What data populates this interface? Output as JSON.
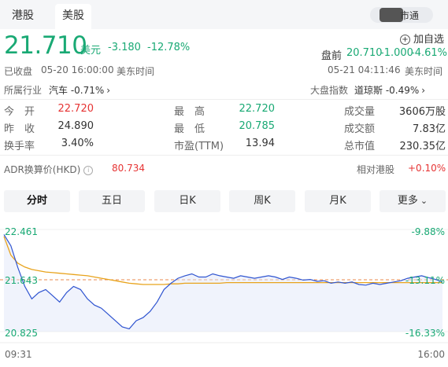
{
  "tabs": {
    "hk": "港股",
    "us": "美股"
  },
  "toggle_label": "市通",
  "quote": {
    "price": "21.710",
    "currency": "美元",
    "change": "-3.180",
    "change_pct": "-12.78%",
    "status": "已收盘",
    "close_time": "05-20 16:00:00",
    "tz": "美东时间",
    "add_watch": "加自选",
    "premarket_label": "盘前",
    "premarket_price": "20.710",
    "premarket_change": "-1.000",
    "premarket_pct": "-4.61%",
    "premarket_time": "05-21 04:11:46",
    "premarket_tz": "美东时间",
    "industry_label": "所属行业",
    "industry": "汽车 -0.71%",
    "index_label": "大盘指数",
    "index": "道琼斯 -0.49%"
  },
  "stats": {
    "open_label": "今　开",
    "open": "22.720",
    "high_label": "最　高",
    "high": "22.720",
    "volume_label": "成交量",
    "volume": "3606万股",
    "prev_label": "昨　收",
    "prev": "24.890",
    "low_label": "最　低",
    "low": "20.785",
    "turnover_label": "成交额",
    "turnover": "7.83亿",
    "rate_label": "换手率",
    "rate": "3.40%",
    "pe_label": "市盈(TTM)",
    "pe": "13.94",
    "mcap_label": "总市值",
    "mcap": "230.35亿"
  },
  "adr": {
    "label": "ADR换算价(HKD)",
    "value": "80.734",
    "rel_label": "相对港股",
    "rel_value": "+0.10%"
  },
  "period_tabs": [
    "分时",
    "五日",
    "日K",
    "周K",
    "月K",
    "更多"
  ],
  "chart_data": {
    "type": "line",
    "y_top_label": "22.461",
    "y_mid_label": "21.643",
    "y_bottom_label": "20.825",
    "pct_top_label": "-9.88%",
    "pct_mid_label": "-13.11%",
    "pct_bottom_label": "-16.33%",
    "x_start": "09:31",
    "x_end": "16:00",
    "ylim": [
      20.825,
      22.461
    ],
    "reference": 21.643,
    "series": [
      {
        "color": "#2f54d0",
        "values": [
          22.38,
          22.2,
          21.85,
          21.55,
          21.35,
          21.45,
          21.5,
          21.4,
          21.3,
          21.45,
          21.55,
          21.5,
          21.35,
          21.25,
          21.2,
          21.1,
          21.0,
          20.9,
          20.87,
          21.0,
          21.05,
          21.15,
          21.3,
          21.5,
          21.6,
          21.68,
          21.72,
          21.75,
          21.7,
          21.7,
          21.75,
          21.72,
          21.7,
          21.68,
          21.72,
          21.7,
          21.68,
          21.7,
          21.72,
          21.7,
          21.66,
          21.7,
          21.68,
          21.65,
          21.66,
          21.63,
          21.64,
          21.6,
          21.62,
          21.6,
          21.62,
          21.58,
          21.57,
          21.6,
          21.58,
          21.6,
          21.62,
          21.64,
          21.68,
          21.7,
          21.72,
          21.69,
          21.66,
          21.62
        ]
      },
      {
        "color": "#e8a31c",
        "values": [
          22.35,
          22.05,
          21.92,
          21.86,
          21.82,
          21.8,
          21.78,
          21.77,
          21.76,
          21.75,
          21.74,
          21.73,
          21.72,
          21.7,
          21.68,
          21.66,
          21.64,
          21.62,
          21.6,
          21.59,
          21.58,
          21.58,
          21.58,
          21.58,
          21.59,
          21.59,
          21.6,
          21.6,
          21.6,
          21.6,
          21.6,
          21.6,
          21.61,
          21.61,
          21.61,
          21.61,
          21.61,
          21.61,
          21.61,
          21.61,
          21.61,
          21.61,
          21.61,
          21.61,
          21.61,
          21.61,
          21.61,
          21.61,
          21.61,
          21.61,
          21.61,
          21.61,
          21.61,
          21.61,
          21.61,
          21.61,
          21.61,
          21.61,
          21.61,
          21.61,
          21.61,
          21.61,
          21.61,
          21.61
        ]
      }
    ]
  }
}
